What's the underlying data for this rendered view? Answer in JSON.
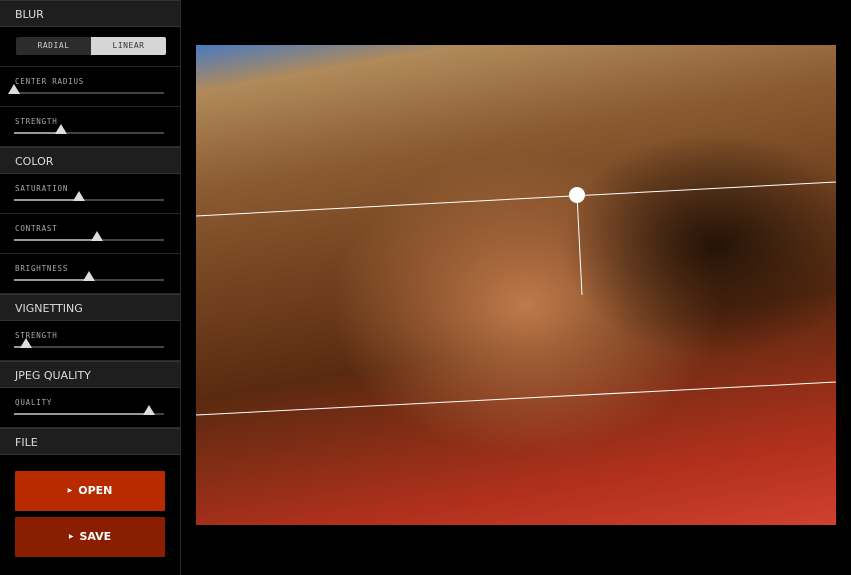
{
  "sidebar": {
    "blur": {
      "header": "BLUR",
      "modes": [
        "RADIAL",
        "LINEAR"
      ],
      "selected_mode": "LINEAR",
      "sliders": [
        {
          "label": "CENTER RADIUS",
          "value": 0
        },
        {
          "label": "STRENGTH",
          "value": 0.31
        }
      ]
    },
    "color": {
      "header": "COLOR",
      "sliders": [
        {
          "label": "SATURATION",
          "value": 0.43
        },
        {
          "label": "CONTRAST",
          "value": 0.55
        },
        {
          "label": "BRIGHTNESS",
          "value": 0.5
        }
      ]
    },
    "vignetting": {
      "header": "VIGNETTING",
      "sliders": [
        {
          "label": "STRENGTH",
          "value": 0.08
        }
      ]
    },
    "jpeg": {
      "header": "JPEG QUALITY",
      "sliders": [
        {
          "label": "QUALITY",
          "value": 0.9
        }
      ]
    },
    "file": {
      "header": "FILE",
      "open_label": "OPEN",
      "save_label": "SAVE",
      "open_color": "#b82a00",
      "save_color": "#8a1e00"
    }
  },
  "canvas": {
    "image": "photo of child lying on red towel at beach",
    "overlay": "linear tilt-shift guide lines with rotation handle"
  }
}
